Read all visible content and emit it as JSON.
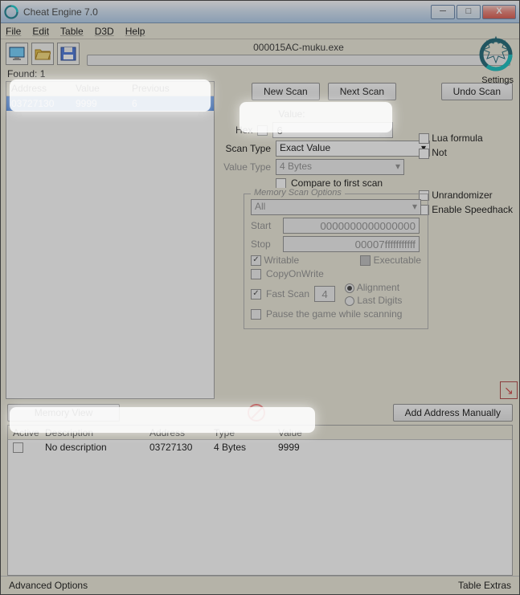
{
  "title": "Cheat Engine 7.0",
  "menu": {
    "file": "File",
    "edit": "Edit",
    "table": "Table",
    "d3d": "D3D",
    "help": "Help"
  },
  "process": "000015AC-muku.exe",
  "found_label": "Found: 1",
  "settings_label": "Settings",
  "left": {
    "cols": {
      "address": "Address",
      "value": "Value",
      "previous": "Previous"
    },
    "rows": [
      {
        "address": "03727130",
        "value": "9999",
        "previous": "6",
        "selected": true
      }
    ]
  },
  "buttons": {
    "new_scan": "New Scan",
    "next_scan": "Next Scan",
    "undo_scan": "Undo Scan",
    "memory_view": "Memory View",
    "add_manual": "Add Address Manually"
  },
  "labels": {
    "value": "Value:",
    "hex": "Hex",
    "scan_type": "Scan Type",
    "value_type": "Value Type",
    "compare_first": "Compare to first scan",
    "lua": "Lua formula",
    "not": "Not",
    "unrand": "Unrandomizer",
    "speedhack": "Enable Speedhack",
    "mem_opts": "Memory Scan Options",
    "all": "All",
    "start": "Start",
    "stop": "Stop",
    "writable": "Writable",
    "executable": "Executable",
    "cow": "CopyOnWrite",
    "fast": "Fast Scan",
    "alignment": "Alignment",
    "last_digits": "Last Digits",
    "pause": "Pause the game while scanning"
  },
  "values": {
    "scan_value": "6",
    "scan_type": "Exact Value",
    "value_type": "4 Bytes",
    "start": "0000000000000000",
    "stop": "00007fffffffffff",
    "fast_val": "4"
  },
  "bottom": {
    "cols": {
      "active": "Active",
      "desc": "Description",
      "address": "Address",
      "type": "Type",
      "value": "Value"
    },
    "rows": [
      {
        "desc": "No description",
        "address": "03727130",
        "type": "4 Bytes",
        "value": "9999"
      }
    ]
  },
  "footer": {
    "adv": "Advanced Options",
    "extras": "Table Extras"
  }
}
